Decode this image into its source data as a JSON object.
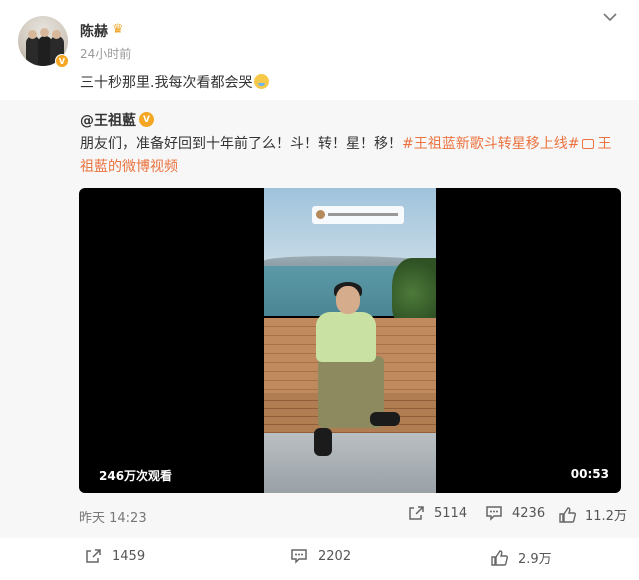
{
  "post": {
    "username": "陈赫",
    "timestamp": "24小时前",
    "text": "三十秒那里.我每次看都会哭",
    "crown_icon": "crown-icon",
    "verified_icon": "verified-badge-icon",
    "emoji": "crying-laughing-emoji"
  },
  "repost": {
    "author": "@王祖藍",
    "text_prefix": "朋友们，准备好回到十年前了么！斗！转！星！移！",
    "hashtag": "#王祖蓝新歌斗转星移上线#",
    "video_link": "王祖藍的微博视频",
    "video": {
      "views": "246万次观看",
      "duration": "00:53"
    },
    "time": "昨天 14:23",
    "stats": {
      "reposts": "5114",
      "comments": "4236",
      "likes": "11.2万"
    }
  },
  "actions": {
    "repost": "1459",
    "comment": "2202",
    "like": "2.9万"
  },
  "colors": {
    "accent": "#eb7340",
    "text": "#333333",
    "muted": "#999999",
    "repost_bg": "#f7f7f7"
  }
}
